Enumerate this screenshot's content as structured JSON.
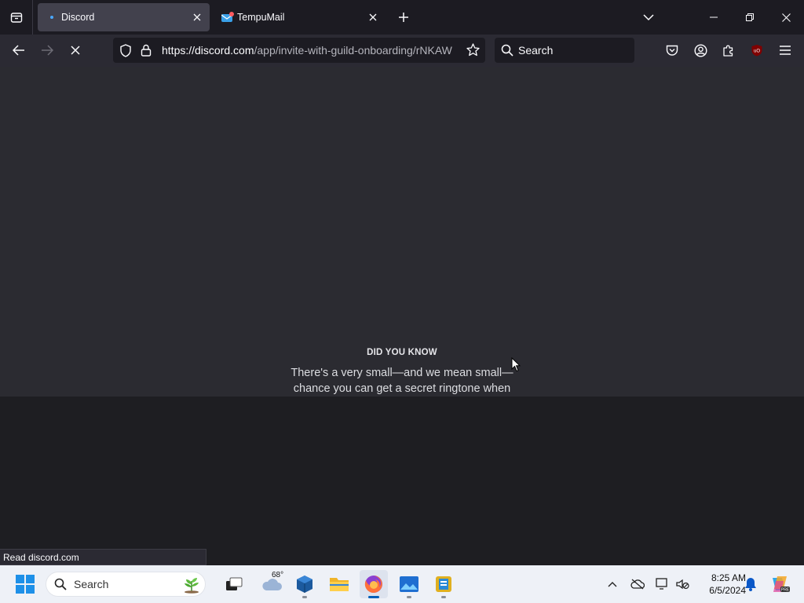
{
  "browser": {
    "tabs": [
      {
        "label": "Discord",
        "active": true
      },
      {
        "label": "TempuMail",
        "active": false
      }
    ],
    "url": {
      "domain": "https://discord.com",
      "path": "/app/invite-with-guild-onboarding/rNKAW"
    },
    "search_placeholder": "Search",
    "status_text": "Read discord.com"
  },
  "content": {
    "did_you_know_title": "DID YOU KNOW",
    "did_you_know_text": "There's a very small—and we mean small—chance you can get a secret ringtone when"
  },
  "taskbar": {
    "search_placeholder": "Search",
    "weather_temp": "68°",
    "time": "8:25 AM",
    "date": "6/5/2024"
  },
  "colors": {
    "tab_active": "#42414d",
    "navbar": "#2b2a33",
    "content_top": "#2b2b31",
    "content_bottom": "#1e1e22",
    "taskbar": "#eef1f7",
    "accent_blue": "#005fb8"
  }
}
